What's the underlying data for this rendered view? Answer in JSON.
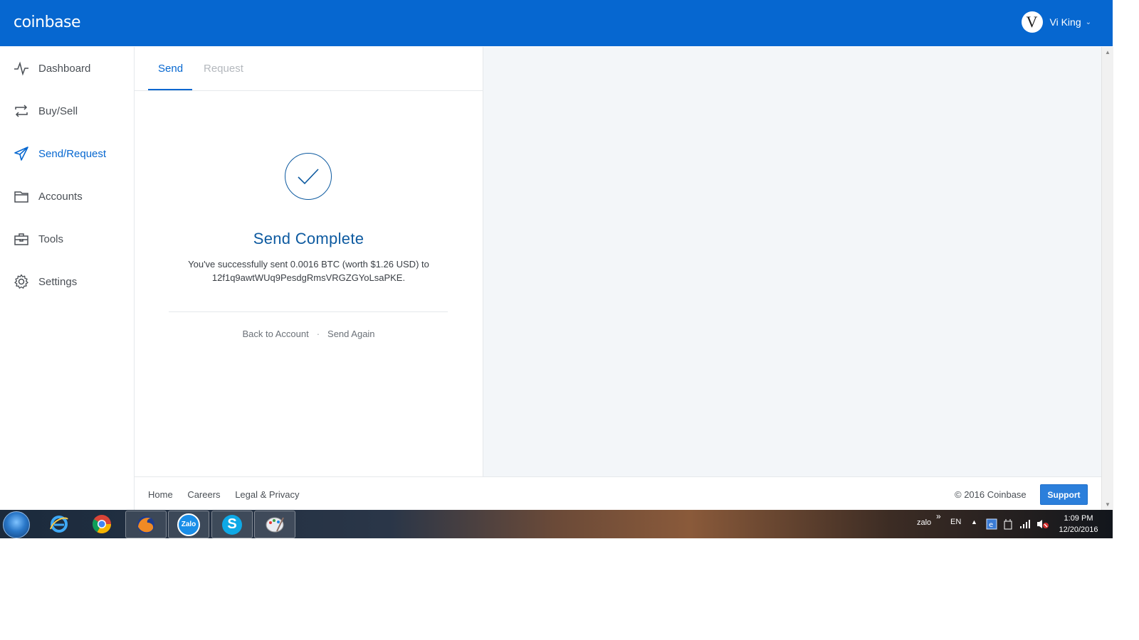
{
  "header": {
    "logo": "coinbase",
    "user": {
      "initial": "V",
      "name": "Vi King"
    }
  },
  "sidebar": {
    "items": [
      {
        "label": "Dashboard",
        "icon": "pulse-icon"
      },
      {
        "label": "Buy/Sell",
        "icon": "repeat-icon"
      },
      {
        "label": "Send/Request",
        "icon": "paper-plane-icon",
        "active": true
      },
      {
        "label": "Accounts",
        "icon": "wallet-icon"
      },
      {
        "label": "Tools",
        "icon": "toolbox-icon"
      },
      {
        "label": "Settings",
        "icon": "gear-icon"
      }
    ]
  },
  "tabs": {
    "send": "Send",
    "request": "Request"
  },
  "result": {
    "title": "Send Complete",
    "message_line1": "You've successfully sent 0.0016 BTC (worth $1.26 USD) to",
    "message_line2": "12f1q9awtWUq9PesdgRmsVRGZGYoLsaPKE.",
    "back_link": "Back to Account",
    "separator": "·",
    "again_link": "Send Again"
  },
  "footer": {
    "links": [
      "Home",
      "Careers",
      "Legal & Privacy"
    ],
    "copyright": "© 2016 Coinbase",
    "support": "Support"
  },
  "taskbar": {
    "apps": [
      "internet-explorer-icon",
      "chrome-icon",
      "firefox-icon",
      "zalo-icon",
      "skype-icon",
      "paint-icon"
    ],
    "zalo_label": "Zalo",
    "tray_zalo": "zalo",
    "tray_chevron": "»",
    "lang": "EN",
    "time": "1:09 PM",
    "date": "12/20/2016"
  },
  "colors": {
    "brand_blue": "#0667d0",
    "title_blue": "#0d5aa0",
    "right_pane": "#f3f6f9"
  }
}
